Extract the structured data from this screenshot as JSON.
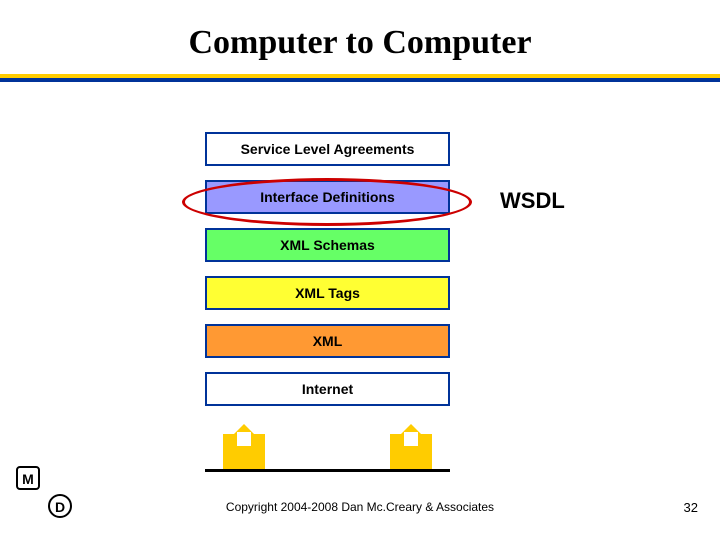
{
  "title": "Computer to Computer",
  "layers": [
    {
      "label": "Service Level Agreements",
      "bg": "#ffffff"
    },
    {
      "label": "Interface Definitions",
      "bg": "#9999ff"
    },
    {
      "label": "XML Schemas",
      "bg": "#66ff66"
    },
    {
      "label": "XML Tags",
      "bg": "#ffff33"
    },
    {
      "label": "XML",
      "bg": "#ff9933"
    },
    {
      "label": "Internet",
      "bg": "#ffffff"
    }
  ],
  "callout": {
    "label": "WSDL",
    "highlights_layer_index": 1
  },
  "badges": {
    "m": "M",
    "d": "D"
  },
  "copyright": "Copyright 2004-2008 Dan Mc.Creary & Associates",
  "page_number": "32"
}
